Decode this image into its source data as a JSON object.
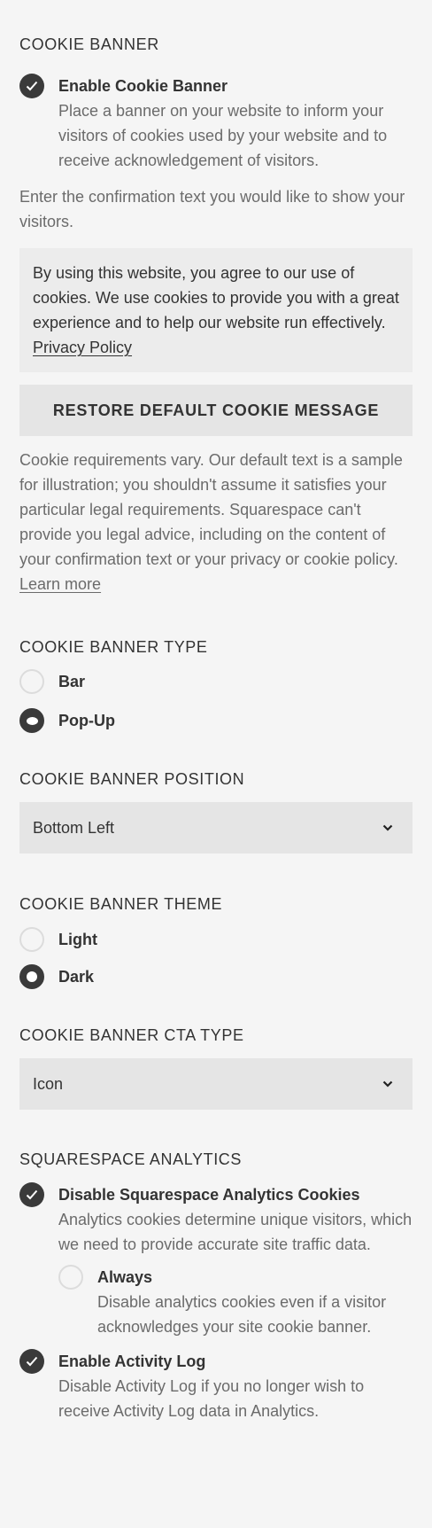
{
  "cookie_banner": {
    "title": "COOKIE BANNER",
    "enable_label": "Enable Cookie Banner",
    "enable_desc": "Place a banner on your website to inform your visitors of cookies used by your website and to receive acknowledgement of visitors.",
    "enable_checked": true,
    "confirm_prompt": "Enter the confirmation text you would like to show your visitors.",
    "message_text": "By using this website, you agree to our use of cookies. We use cookies to provide you with a great experience and to help our website run effectively.",
    "message_link": "Privacy Policy",
    "restore_button": "RESTORE DEFAULT COOKIE MESSAGE",
    "disclaimer": "Cookie requirements vary. Our default text is a sample for illustration; you shouldn't assume it satisfies your particular legal requirements. Squarespace can't provide you legal advice, including on the content of your confirmation text or your privacy or cookie policy.",
    "learn_more": "Learn more"
  },
  "banner_type": {
    "title": "COOKIE BANNER TYPE",
    "options": [
      "Bar",
      "Pop-Up"
    ],
    "selected": "Pop-Up"
  },
  "banner_position": {
    "title": "COOKIE BANNER POSITION",
    "value": "Bottom Left"
  },
  "banner_theme": {
    "title": "COOKIE BANNER THEME",
    "options": [
      "Light",
      "Dark"
    ],
    "selected": "Dark"
  },
  "cta_type": {
    "title": "COOKIE BANNER CTA TYPE",
    "value": "Icon"
  },
  "analytics": {
    "title": "SQUARESPACE ANALYTICS",
    "disable_label": "Disable Squarespace Analytics Cookies",
    "disable_desc": "Analytics cookies determine unique visitors, which we need to provide accurate site traffic data.",
    "disable_checked": true,
    "always_label": "Always",
    "always_desc": "Disable analytics cookies even if a visitor acknowledges your site cookie banner.",
    "always_checked": false,
    "activity_label": "Enable Activity Log",
    "activity_desc": "Disable Activity Log if you no longer wish to receive Activity Log data in Analytics.",
    "activity_checked": true
  },
  "colors": {
    "background": "#f5f5f5",
    "control_dark": "#3a3a3a",
    "field_bg": "#e5e5e5",
    "muted_text": "#6b6b6b"
  }
}
